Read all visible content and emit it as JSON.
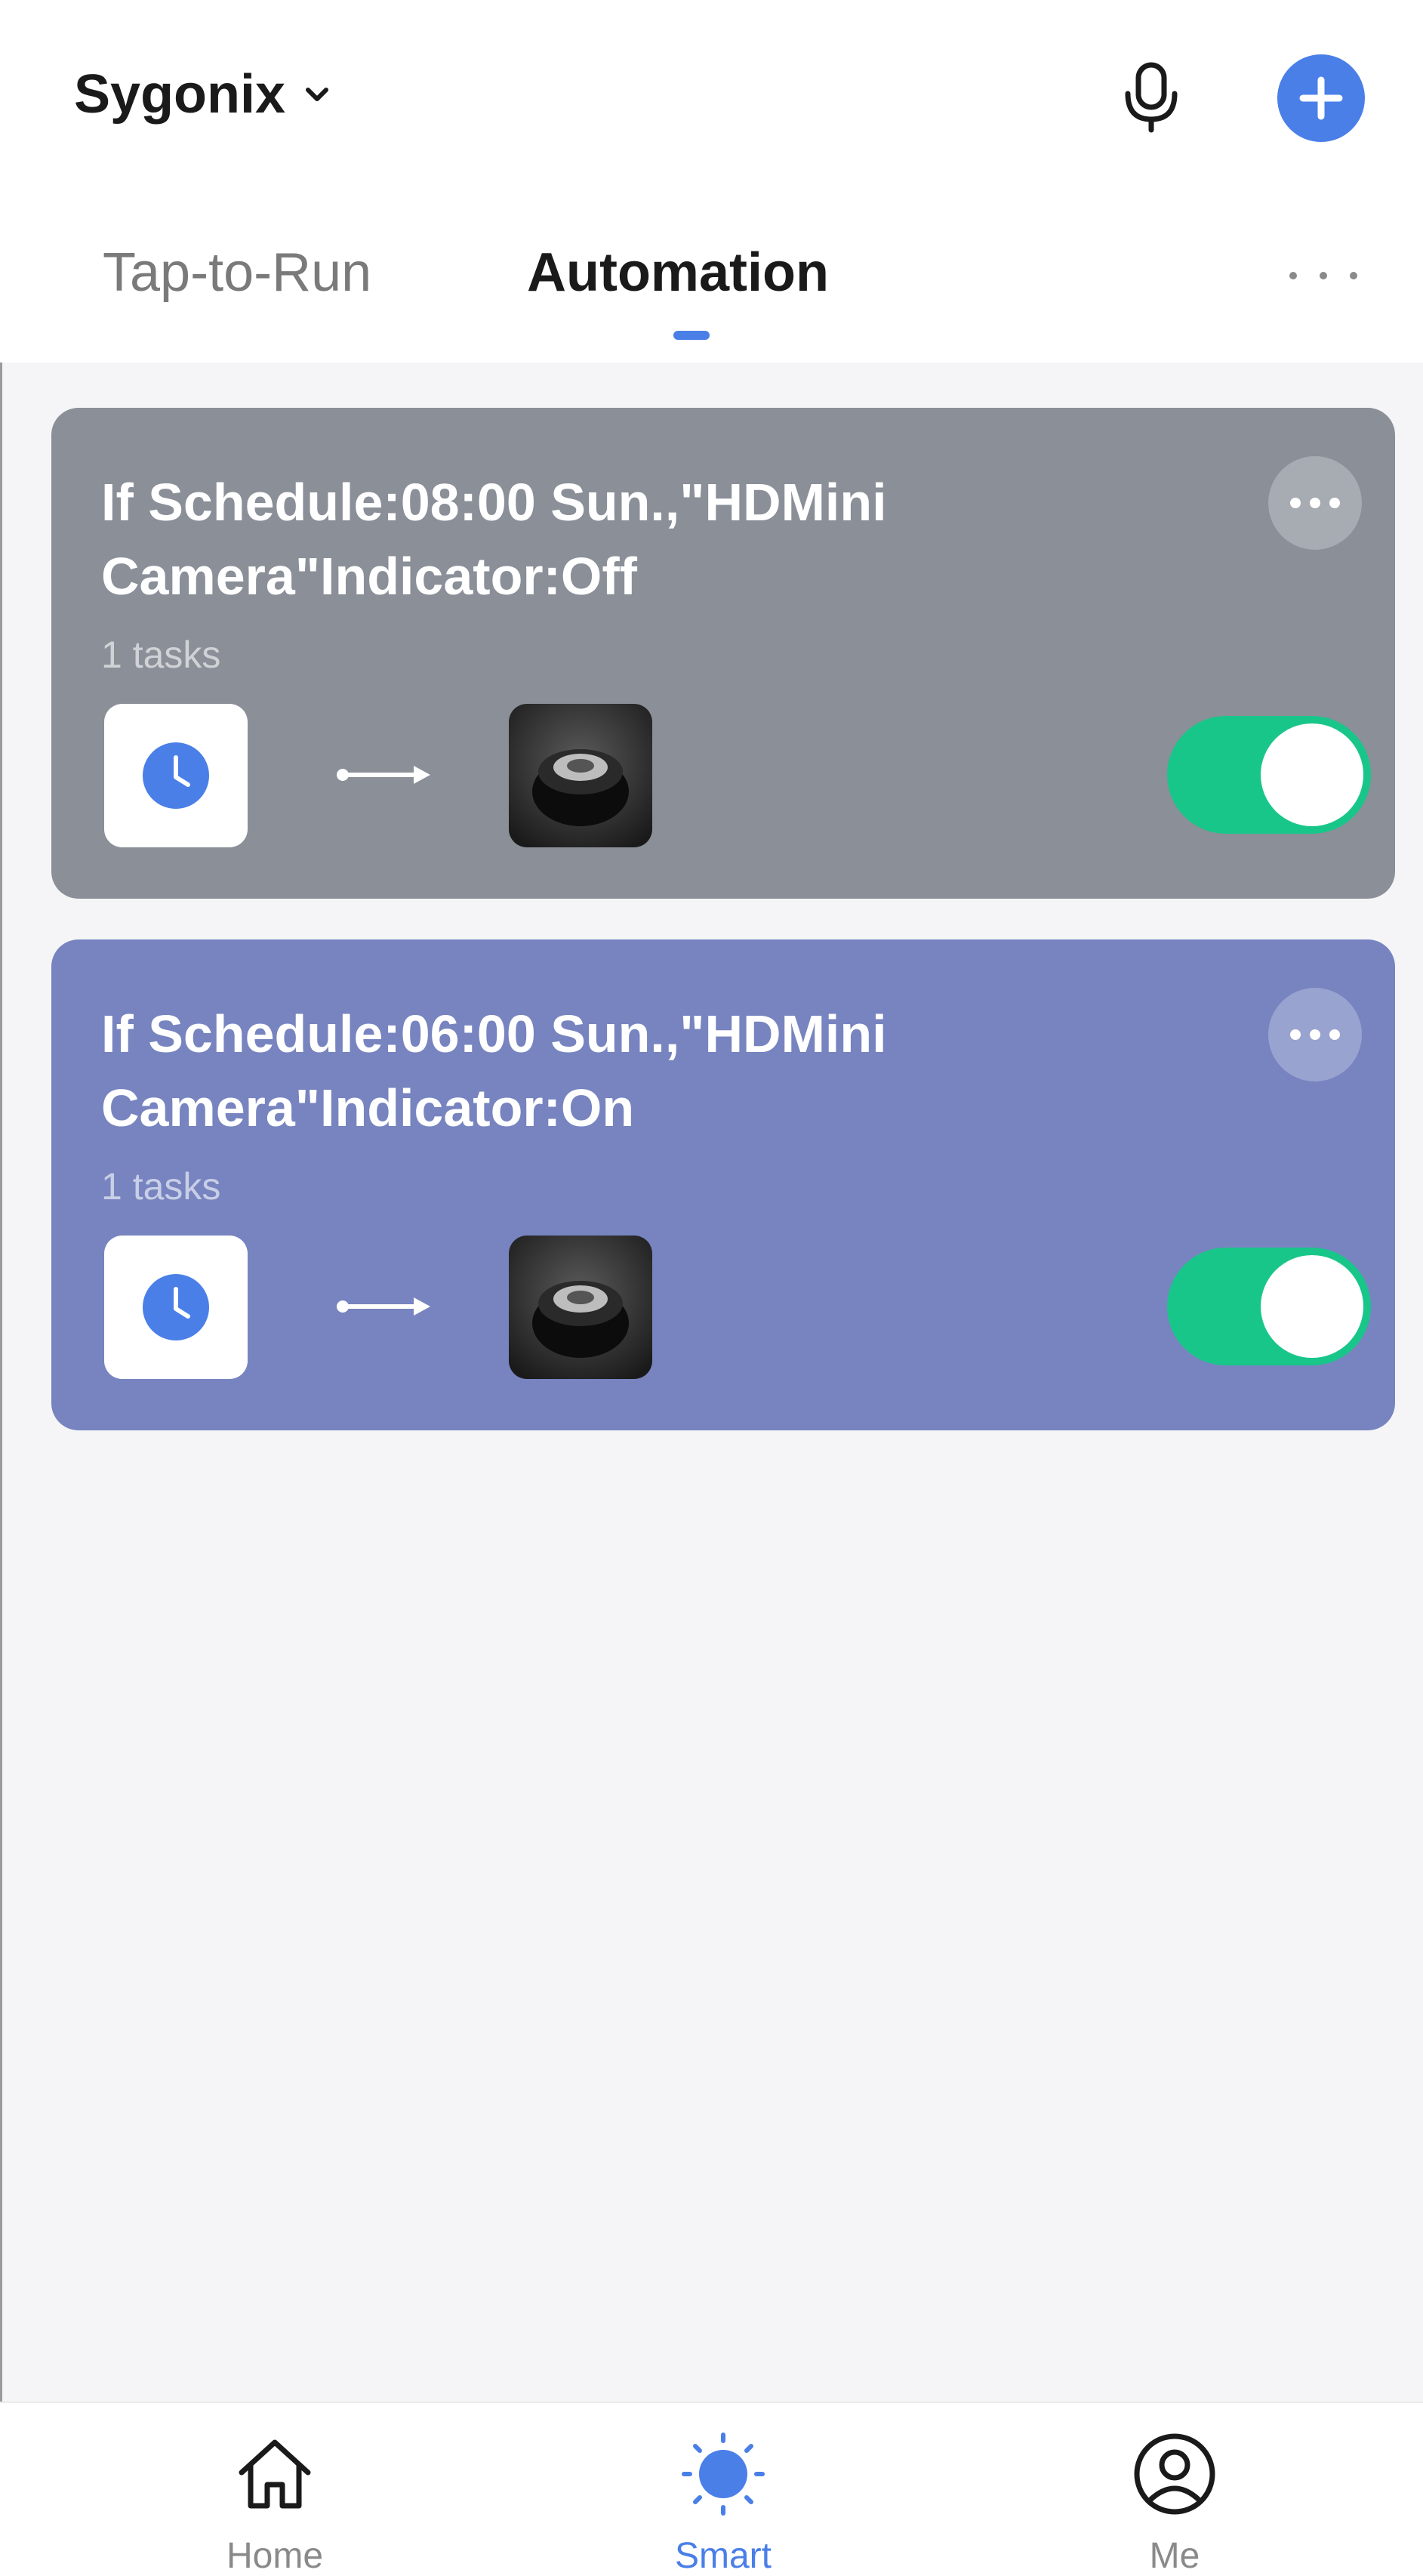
{
  "header": {
    "home_name": "Sygonix",
    "tabs": [
      {
        "label": "Tap-to-Run",
        "active": false
      },
      {
        "label": "Automation",
        "active": true
      }
    ]
  },
  "automations": [
    {
      "title": "If Schedule:08:00 Sun.,\"HDMini Camera\"Indicator:Off",
      "tasks": "1 tasks",
      "enabled": true,
      "card_color": "#8a8f98"
    },
    {
      "title": "If Schedule:06:00 Sun.,\"HDMini Camera\"Indicator:On",
      "tasks": "1 tasks",
      "enabled": true,
      "card_color": "#7784c0"
    }
  ],
  "bottom_nav": [
    {
      "label": "Home",
      "icon": "home-icon",
      "active": false
    },
    {
      "label": "Smart",
      "icon": "smart-icon",
      "active": true
    },
    {
      "label": "Me",
      "icon": "profile-icon",
      "active": false
    }
  ],
  "colors": {
    "accent": "#4a7fe8",
    "toggle_on": "#19c68a",
    "background": "#f5f5f7"
  }
}
